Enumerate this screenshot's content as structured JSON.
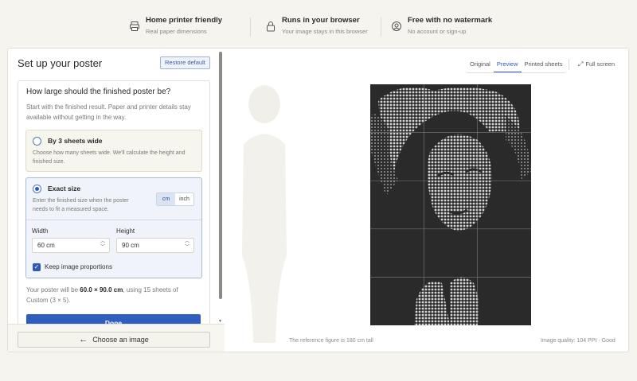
{
  "features": [
    {
      "title": "Home printer friendly",
      "subtitle": "Real paper dimensions",
      "icon": "printer-icon"
    },
    {
      "title": "Runs in your browser",
      "subtitle": "Your image stays in this browser",
      "icon": "lock-icon"
    },
    {
      "title": "Free with no watermark",
      "subtitle": "No account or sign-up",
      "icon": "user-circle-icon"
    }
  ],
  "setup": {
    "title": "Set up your poster",
    "restore_label": "Restore default",
    "question": "How large should the finished poster be?",
    "question_sub": "Start with the finished result. Paper and printer details stay available without getting in the way.",
    "option_sheets": {
      "label": "By 3 sheets wide",
      "desc": "Choose how many sheets wide. We'll calculate the height and finished size.",
      "selected": false
    },
    "option_exact": {
      "label": "Exact size",
      "desc": "Enter the finished size when the poster needs to fit a measured space.",
      "selected": true,
      "units": [
        "cm",
        "inch"
      ],
      "active_unit": "cm"
    },
    "width_label": "Width",
    "width_value": "60 cm",
    "height_label": "Height",
    "height_value": "90 cm",
    "keep_proportions_label": "Keep image proportions",
    "keep_proportions": true,
    "summary_pre": "Your poster will be ",
    "summary_size": "60.0 × 90.0 cm",
    "summary_post": ", using 15 sheets of Custom (3 × 5).",
    "done_label": "Done",
    "choose_label": "Choose an image"
  },
  "preview": {
    "tabs": [
      "Original",
      "Preview",
      "Printed sheets"
    ],
    "active_tab": "Preview",
    "fullscreen_label": "Full screen",
    "reference_text": "The reference figure is 180 cm tall",
    "quality_text": "Image quality: 104 PPI · Good",
    "grid_columns": 3,
    "grid_rows": 5
  },
  "colors": {
    "accent": "#2f5dc0",
    "page_bg": "#f5f4ee"
  }
}
